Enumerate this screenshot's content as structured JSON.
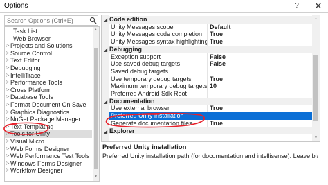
{
  "window": {
    "title": "Options",
    "help_glyph": "?",
    "close_glyph": "✕"
  },
  "search": {
    "placeholder": "Search Options (Ctrl+E)",
    "icon": "search-icon"
  },
  "tree": {
    "items": [
      {
        "label": "Task List",
        "child": true
      },
      {
        "label": "Web Browser",
        "child": true
      },
      {
        "label": "Projects and Solutions",
        "child": false
      },
      {
        "label": "Source Control",
        "child": false
      },
      {
        "label": "Text Editor",
        "child": false
      },
      {
        "label": "Debugging",
        "child": false
      },
      {
        "label": "IntelliTrace",
        "child": false
      },
      {
        "label": "Performance Tools",
        "child": false
      },
      {
        "label": "Cross Platform",
        "child": false
      },
      {
        "label": "Database Tools",
        "child": false
      },
      {
        "label": "Format Document On Save",
        "child": false
      },
      {
        "label": "Graphics Diagnostics",
        "child": false
      },
      {
        "label": "NuGet Package Manager",
        "child": false
      },
      {
        "label": "Text Templating",
        "child": false
      },
      {
        "label": "Tools for Unity",
        "child": false,
        "selected": true
      },
      {
        "label": "Visual Micro",
        "child": false
      },
      {
        "label": "Web Forms Designer",
        "child": false
      },
      {
        "label": "Web Performance Test Tools",
        "child": false
      },
      {
        "label": "Windows Forms Designer",
        "child": false
      },
      {
        "label": "Workflow Designer",
        "child": false
      }
    ]
  },
  "grid": {
    "rows": [
      {
        "type": "category",
        "name": "Code edition"
      },
      {
        "type": "property",
        "name": "Unity Messages scope",
        "value": "Default"
      },
      {
        "type": "property",
        "name": "Unity Messages code completion",
        "value": "True"
      },
      {
        "type": "property",
        "name": "Unity Messages syntax highlighting",
        "value": "True"
      },
      {
        "type": "category",
        "name": "Debugging"
      },
      {
        "type": "property",
        "name": "Exception support",
        "value": "False"
      },
      {
        "type": "property",
        "name": "Use saved debug targets",
        "value": "False"
      },
      {
        "type": "property",
        "name": "Saved debug targets",
        "value": ""
      },
      {
        "type": "property",
        "name": "Use temporary debug targets",
        "value": "True"
      },
      {
        "type": "property",
        "name": "Maximum temporary debug targets",
        "value": "10"
      },
      {
        "type": "property",
        "name": "Preferred Android Sdk Root",
        "value": ""
      },
      {
        "type": "category",
        "name": "Documentation"
      },
      {
        "type": "property",
        "name": "Use external browser",
        "value": "True"
      },
      {
        "type": "property",
        "name": "Preferred Unity installation",
        "value": "",
        "selected": true
      },
      {
        "type": "property",
        "name": "Generate documentation files",
        "value": "True"
      },
      {
        "type": "category",
        "name": "Explorer"
      }
    ]
  },
  "description": {
    "title": "Preferred Unity installation",
    "text": "Preferred Unity installation path (for documentation and intellisense). Leave blank for auto..."
  },
  "colors": {
    "selection": "#0b6fd6",
    "annotation": "#e8202a"
  }
}
